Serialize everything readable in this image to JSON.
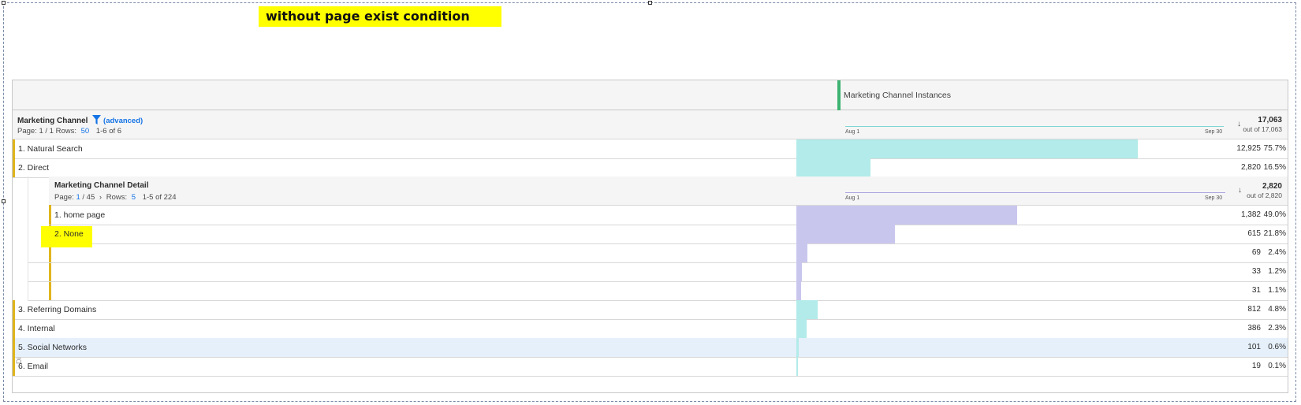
{
  "annotation": "without page exist condition",
  "metric_header": "Marketing Channel Instances",
  "outer": {
    "title": "Marketing Channel",
    "filter_label": "(advanced)",
    "page_label": "Page: 1 / 1",
    "rows_label": "Rows:",
    "rows_value": "50",
    "range": "1-6 of 6",
    "date_start": "Aug 1",
    "date_end": "Sep 30",
    "total": "17,063",
    "out_of": "out of 17,063",
    "sort_icon": "arrow-down-icon"
  },
  "inner": {
    "title": "Marketing Channel Detail",
    "page_label": "Page:",
    "page_value": "1",
    "page_total": "/ 45",
    "rows_label": "Rows:",
    "rows_value": "5",
    "range": "1-5 of 224",
    "date_start": "Aug 1",
    "date_end": "Sep 30",
    "total": "2,820",
    "out_of": "out of 2,820",
    "side_label": "Direct"
  },
  "rows_top": [
    {
      "label": "1.  Natural Search",
      "value": "12,925",
      "pct": "75.7%",
      "share": 0.757
    },
    {
      "label": "2.  Direct",
      "value": "2,820",
      "pct": "16.5%",
      "share": 0.165
    }
  ],
  "rows_inner": [
    {
      "label": "1.  home page",
      "value": "1,382",
      "pct": "49.0%",
      "share": 0.49
    },
    {
      "label": "2.  None",
      "value": "615",
      "pct": "21.8%",
      "share": 0.218
    },
    {
      "label": "",
      "value": "69",
      "pct": "2.4%",
      "share": 0.024
    },
    {
      "label": "",
      "value": "33",
      "pct": "1.2%",
      "share": 0.012
    },
    {
      "label": "",
      "value": "31",
      "pct": "1.1%",
      "share": 0.011
    }
  ],
  "rows_bottom": [
    {
      "label": "3.  Referring Domains",
      "value": "812",
      "pct": "4.8%",
      "share": 0.048
    },
    {
      "label": "4.  Internal",
      "value": "386",
      "pct": "2.3%",
      "share": 0.023
    },
    {
      "label": "5.  Social Networks",
      "value": "101",
      "pct": "0.6%",
      "share": 0.006
    },
    {
      "label": "6.  Email",
      "value": "19",
      "pct": "0.1%",
      "share": 0.001
    }
  ],
  "colors": {
    "outer_bar": "#b2ebe9",
    "inner_bar": "#c9c6ee",
    "accent": "#e0b51e",
    "highlight": "#ffff00",
    "selected_row": "#e6f0fb",
    "metric_marker": "#3cb371"
  }
}
